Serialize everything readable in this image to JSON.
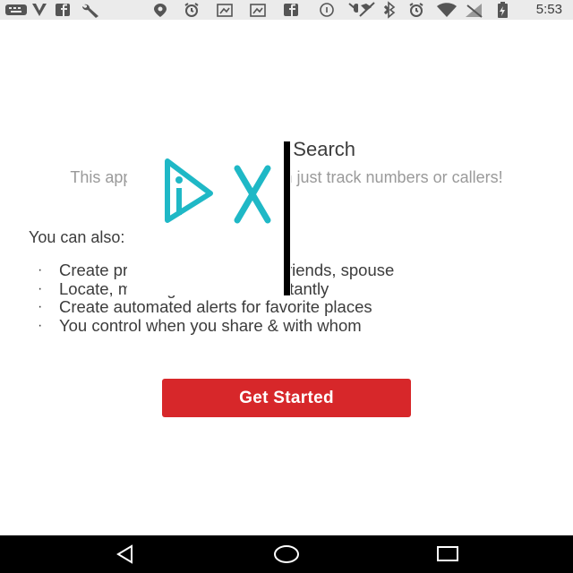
{
  "status_bar": {
    "icons": [
      "keyboard-icon",
      "v-logo-icon",
      "facebook-icon",
      "wrench-icon",
      "location-pin-icon",
      "alarm-icon",
      "image-icon",
      "image-icon",
      "facebook-icon",
      "info-icon",
      "no-mic-icon",
      "bluetooth-icon",
      "alarm-icon",
      "wifi-icon",
      "no-signal-icon",
      "battery-charging-icon"
    ],
    "time": "5:53"
  },
  "screen": {
    "title": "Number Search",
    "subtitle": "This app does much more than just track numbers or callers!",
    "intro": "You can also:",
    "features": [
      "Create private groups to track friends, spouse",
      "Locate, message & connect instantly",
      "Create automated alerts for favorite places",
      "You control when you share & with whom"
    ],
    "cta_label": "Get Started"
  },
  "ad_overlay": {
    "icons": [
      "adchoices-icon",
      "close-icon"
    ],
    "accent": "#1fb8c6"
  },
  "nav_bar": {
    "buttons": [
      "back-icon",
      "home-icon",
      "recents-icon"
    ]
  },
  "colors": {
    "cta": "#d7272a",
    "status_bar": "#ebebeb",
    "nav_bar": "#000000"
  }
}
